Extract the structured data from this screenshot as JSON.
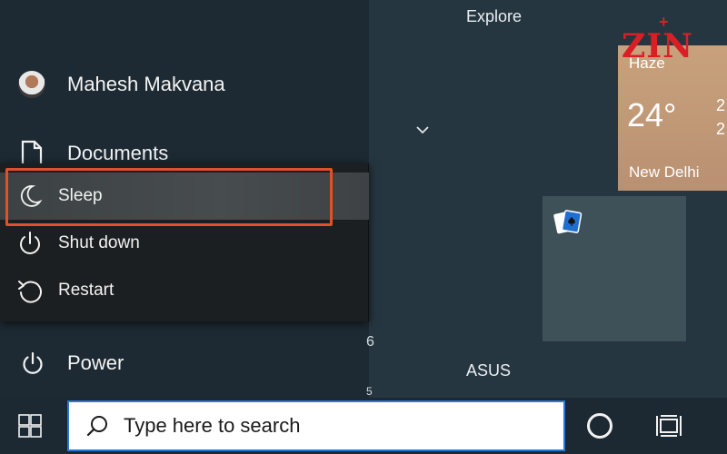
{
  "start_menu": {
    "user_name": "Mahesh Makvana",
    "documents_label": "Documents",
    "power_label": "Power"
  },
  "power_flyout": {
    "items": [
      {
        "label": "Sleep",
        "icon": "moon-icon",
        "selected": true
      },
      {
        "label": "Shut down",
        "icon": "power-icon",
        "selected": false
      },
      {
        "label": "Restart",
        "icon": "restart-icon",
        "selected": false
      }
    ]
  },
  "tiles": {
    "explore_title": "Explore",
    "asus_title": "ASUS",
    "stray_text": [
      "6",
      "5"
    ],
    "weather": {
      "condition": "Haze",
      "temperature": "24°",
      "high": "2",
      "low": "2",
      "city": "New Delhi"
    }
  },
  "watermark": {
    "text": "ZIN",
    "mark": "+"
  },
  "taskbar": {
    "search_placeholder": "Type here to search"
  },
  "colors": {
    "highlight": "#e2502a",
    "search_border": "#2a78d6",
    "watermark": "#d91f26"
  }
}
